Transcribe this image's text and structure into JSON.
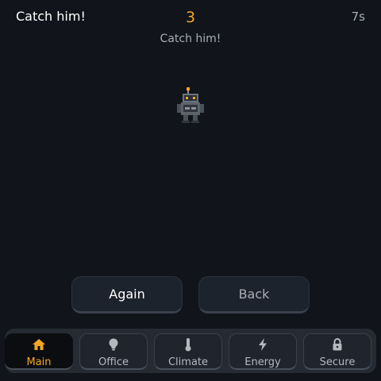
{
  "header": {
    "title": "Catch him!",
    "score": "3",
    "timer": "7s"
  },
  "hint": "Catch him!",
  "sprite": {
    "icon": "robot-icon"
  },
  "buttons": {
    "again": "Again",
    "back": "Back"
  },
  "nav": {
    "items": [
      {
        "label": "Main",
        "icon": "home-icon",
        "active": true
      },
      {
        "label": "Office",
        "icon": "lightbulb-icon",
        "active": false
      },
      {
        "label": "Climate",
        "icon": "thermometer-icon",
        "active": false
      },
      {
        "label": "Energy",
        "icon": "lightning-icon",
        "active": false
      },
      {
        "label": "Secure",
        "icon": "lock-icon",
        "active": false
      }
    ]
  },
  "colors": {
    "accent": "#f5a623",
    "background": "#11141a",
    "muted_text": "#a8adb5"
  }
}
